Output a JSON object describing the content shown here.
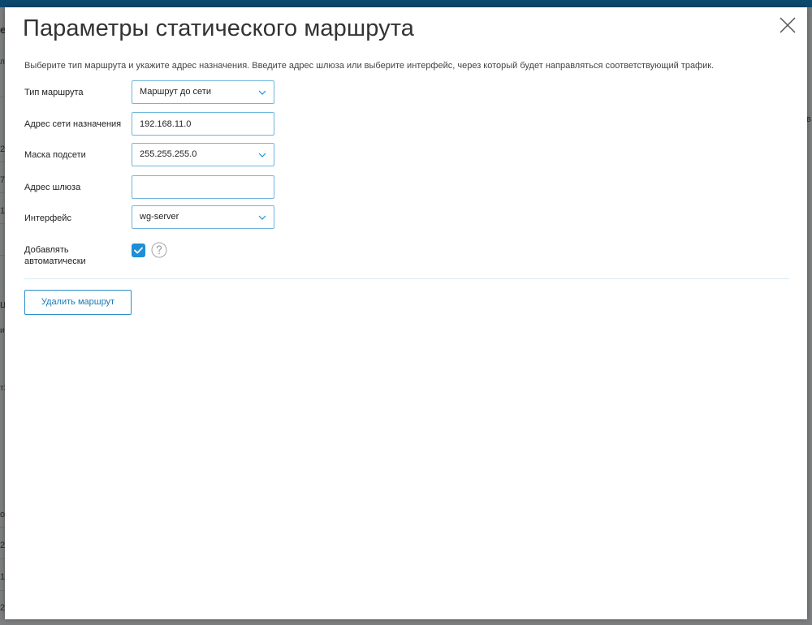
{
  "modal": {
    "title": "Параметры статического маршрута",
    "description": "Выберите тип маршрута и укажите адрес назначения. Введите адрес шлюза или выберите интерфейс, через который будет направляться соответствующий трафик."
  },
  "form": {
    "route_type": {
      "label": "Тип маршрута",
      "value": "Маршрут до сети"
    },
    "destination_network": {
      "label": "Адрес сети назначения",
      "value": "192.168.11.0"
    },
    "subnet_mask": {
      "label": "Маска подсети",
      "value": "255.255.255.0"
    },
    "gateway": {
      "label": "Адрес шлюза",
      "value": ""
    },
    "interface": {
      "label": "Интерфейс",
      "value": "wg-server"
    },
    "auto_add": {
      "label_line1": "Добавлять",
      "label_line2": "автоматически",
      "checked": true
    }
  },
  "actions": {
    "delete_label": "Удалить маршрут"
  },
  "background_fragments": [
    "е.",
    "лт",
    "2",
    "72",
    "19",
    "ц",
    "ис",
    "т3",
    "о",
    "2",
    "19",
    "24",
    "в"
  ],
  "colors": {
    "accent": "#1d8fd6",
    "field_border": "#6fb6de",
    "topbar": "#0b4a6e"
  },
  "icons": {
    "close": "close-icon",
    "chevron": "chevron-down-icon",
    "check": "check-icon",
    "help": "question-icon"
  }
}
